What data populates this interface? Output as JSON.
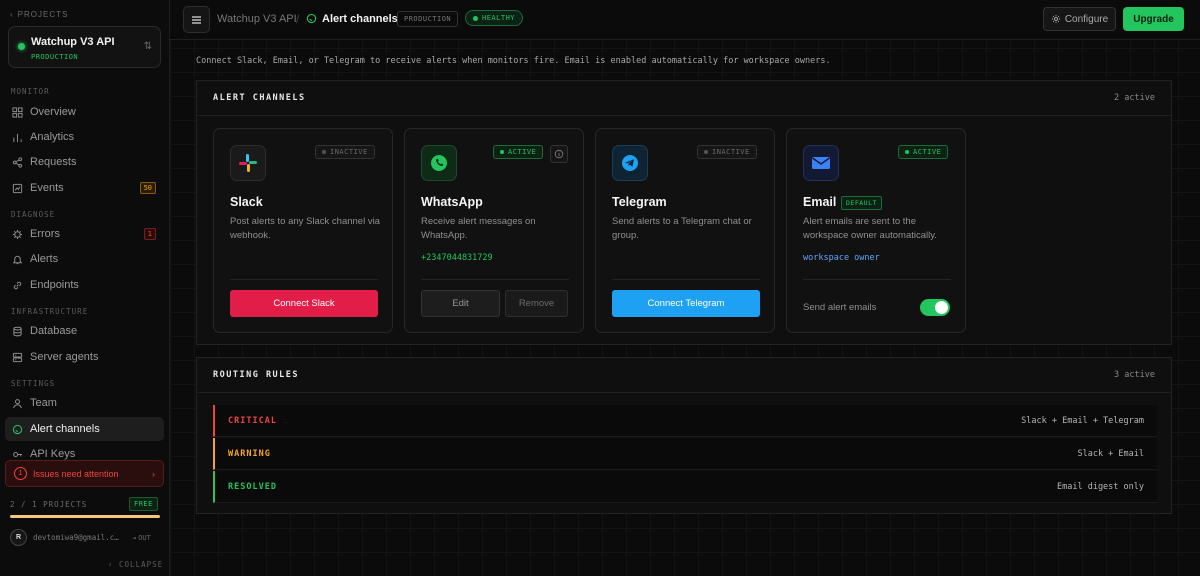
{
  "sidebar": {
    "back_label": "PROJECTS",
    "project": {
      "name": "Watchup V3 API",
      "env": "PRODUCTION"
    },
    "sections": {
      "monitor": "MONITOR",
      "diagnose": "DIAGNOSE",
      "infrastructure": "INFRASTRUCTURE",
      "settings": "SETTINGS"
    },
    "items": [
      {
        "label": "Overview"
      },
      {
        "label": "Analytics"
      },
      {
        "label": "Requests"
      },
      {
        "label": "Events",
        "count": "50"
      },
      {
        "label": "Errors",
        "count": "1"
      },
      {
        "label": "Alerts"
      },
      {
        "label": "Endpoints"
      },
      {
        "label": "Database"
      },
      {
        "label": "Server agents"
      },
      {
        "label": "Team"
      },
      {
        "label": "Alert channels"
      },
      {
        "label": "API Keys"
      }
    ],
    "issues": {
      "count": "1",
      "label": "Issues need attention"
    },
    "plan": {
      "usage": "2 / 1 PROJECTS",
      "tier": "FREE"
    },
    "user": {
      "initial": "R",
      "email": "devtomiwa9@gmail.c…",
      "logout": "OUT"
    },
    "collapse_label": "COLLAPSE"
  },
  "header": {
    "breadcrumb_parent": "Watchup V3 API",
    "breadcrumb_sep": "/",
    "breadcrumb_current": "Alert channels",
    "env_pill": "PRODUCTION",
    "health_pill": "HEALTHY",
    "configure_label": "Configure",
    "upgrade_label": "Upgrade"
  },
  "intro": "Connect Slack, Email, or Telegram to receive alerts when monitors fire. Email is enabled automatically for workspace owners.",
  "alert_channels": {
    "title": "ALERT CHANNELS",
    "count": "2 active",
    "cards": [
      {
        "name": "Slack",
        "status": "INACTIVE",
        "description": "Post alerts to any Slack channel via webhook.",
        "button": "Connect Slack",
        "icon": "slack-icon"
      },
      {
        "name": "WhatsApp",
        "status": "ACTIVE",
        "description": "Receive alert messages on WhatsApp.",
        "detail": "+2347044831729",
        "edit": "Edit",
        "remove": "Remove",
        "icon": "whatsapp-icon"
      },
      {
        "name": "Telegram",
        "status": "INACTIVE",
        "description": "Send alerts to a Telegram chat or group.",
        "button": "Connect Telegram",
        "icon": "telegram-icon"
      },
      {
        "name": "Email",
        "badge": "DEFAULT",
        "status": "ACTIVE",
        "description": "Alert emails are sent to the workspace owner automatically.",
        "detail": "workspace owner",
        "toggle_label": "Send alert emails",
        "toggle_on": true,
        "icon": "mail-icon"
      }
    ]
  },
  "routing_rules": {
    "title": "ROUTING RULES",
    "count": "3 active",
    "rules": [
      {
        "level": "CRITICAL",
        "channels": "Slack + Email + Telegram",
        "color": "#ef4444"
      },
      {
        "level": "WARNING",
        "channels": "Slack + Email",
        "color": "#f5a524"
      },
      {
        "level": "RESOLVED",
        "channels": "Email digest only",
        "color": "#22c55e"
      }
    ]
  },
  "colors": {
    "accent": "#22c55e",
    "slack_button": "#e11d48",
    "telegram_button": "#1ea1f2",
    "danger": "#ef4444",
    "warning": "#f5a524"
  }
}
